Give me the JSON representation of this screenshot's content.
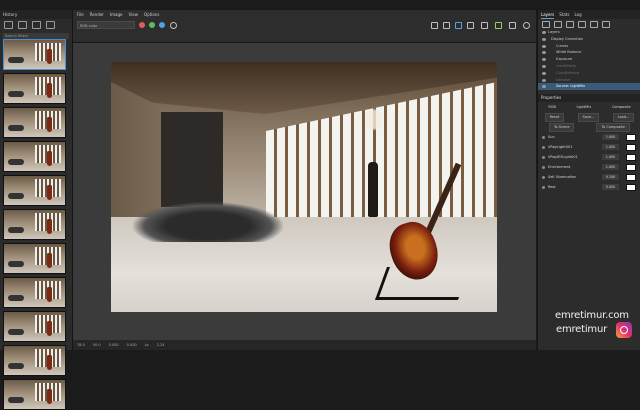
{
  "history": {
    "title": "History",
    "search_placeholder": "Search filters",
    "thumbnail_count": 11
  },
  "menu": [
    "File",
    "Render",
    "Image",
    "View",
    "Options"
  ],
  "viewport": {
    "channel": "RGB color",
    "status": [
      "78.0",
      "50.0",
      "0.000",
      "0.000",
      "Lo",
      "2.24"
    ]
  },
  "right": {
    "tabs": [
      "Layers",
      "Stats",
      "Log"
    ],
    "layers": [
      {
        "label": "Layers",
        "state": "normal"
      },
      {
        "label": "Display Correction",
        "state": "normal"
      },
      {
        "label": "Curves",
        "state": "normal"
      },
      {
        "label": "White Balance",
        "state": "normal"
      },
      {
        "label": "Exposure",
        "state": "normal"
      },
      {
        "label": "LensEffects",
        "state": "dim"
      },
      {
        "label": "ColorBalance",
        "state": "dim"
      },
      {
        "label": "Denoise",
        "state": "dim"
      },
      {
        "label": "Source: LightMix",
        "state": "sel"
      }
    ],
    "properties_title": "Properties",
    "radio": [
      "RGB",
      "LightMix",
      "Composite"
    ],
    "buttons1": [
      "Reset",
      "Save...",
      "Load..."
    ],
    "buttons2": [
      "To Scene",
      "To Composite"
    ],
    "sliders": [
      {
        "label": "Sun",
        "value": "1.000"
      },
      {
        "label": "VRayLight001",
        "value": "1.000"
      },
      {
        "label": "VRayIESLight001",
        "value": "1.000"
      },
      {
        "label": "Environment",
        "value": "1.000"
      },
      {
        "label": "Self Illumination",
        "value": "0.100"
      },
      {
        "label": "Rest",
        "value": "0.000"
      }
    ]
  },
  "watermark": {
    "line1": "emretimur.com",
    "line2": "emretimur"
  }
}
